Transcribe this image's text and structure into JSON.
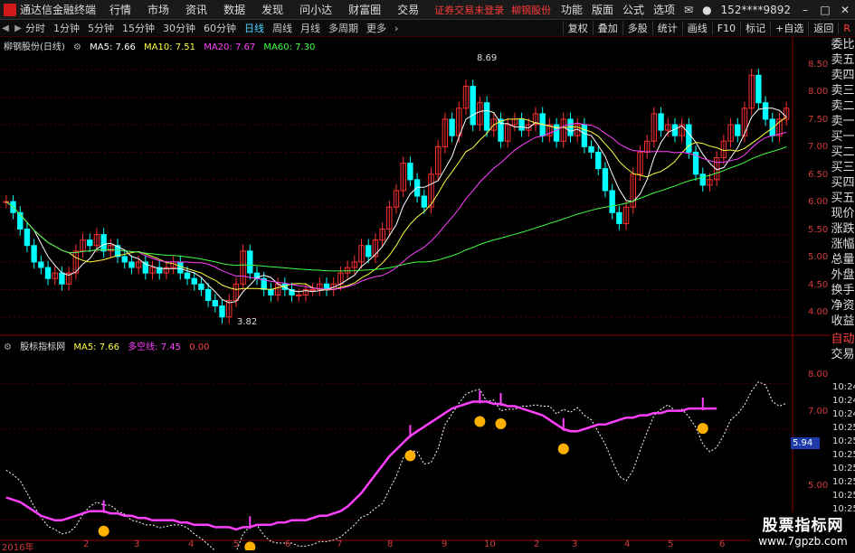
{
  "app": {
    "title": "通达信金融终端"
  },
  "menu": {
    "items": [
      "行情",
      "市场",
      "资讯",
      "数据",
      "发现",
      "问小达",
      "财富圈",
      "交易"
    ],
    "warning": "证券交易未登录",
    "stock_name": "柳钢股份",
    "right_items": [
      "功能",
      "版面",
      "公式",
      "选项"
    ],
    "account": "152****9892"
  },
  "toolbar": {
    "periods": [
      "分时",
      "1分钟",
      "5分钟",
      "15分钟",
      "30分钟",
      "60分钟",
      "日线",
      "周线",
      "月线",
      "多周期",
      "更多"
    ],
    "active": "日线",
    "right_buttons": [
      "复权",
      "叠加",
      "多股",
      "统计",
      "画线",
      "F10",
      "标记",
      "+自选",
      "返回"
    ],
    "r_label": "R"
  },
  "main_panel": {
    "title": "柳钢股份(日线)",
    "ma5": "MA5: 7.66",
    "ma10": "MA10: 7.51",
    "ma20": "MA20: 7.67",
    "ma60": "MA60: 7.30",
    "high_label": "8.69",
    "low_label": "3.82",
    "y_ticks": [
      "8.50",
      "8.00",
      "7.50",
      "7.00",
      "6.50",
      "6.00",
      "5.50",
      "5.00",
      "4.50",
      "4.00"
    ]
  },
  "sub_panel": {
    "title": "股标指标网",
    "ma5": "MA5: 7.66",
    "line_name": "多空线: 7.45",
    "extra": "0.00",
    "y_ticks": [
      "8.00",
      "7.00",
      "5.00"
    ],
    "current_value": "5.94"
  },
  "sidebar": {
    "items": [
      "委比",
      "卖五",
      "卖四",
      "卖三",
      "卖二",
      "卖一",
      "买一",
      "买二",
      "买三",
      "买四",
      "买五",
      "现价",
      "涨跌",
      "涨幅",
      "总量",
      "外盘",
      "换手",
      "净资",
      "收益"
    ],
    "auto_label": "自动",
    "trade_label": "交易",
    "times": [
      "10:24",
      "10:24",
      "10:24",
      "10:25",
      "10:25",
      "10:25",
      "10:25",
      "10:25",
      "10:25",
      "10:25"
    ]
  },
  "x_axis": {
    "labels": [
      "2016年",
      "2",
      "3",
      "4",
      "5",
      "6",
      "7",
      "8",
      "9",
      "10",
      "2",
      "3",
      "4",
      "5",
      "6"
    ]
  },
  "watermark": {
    "line1": "股票指标网",
    "line2": "www.7gpzb.com"
  },
  "colors": {
    "up": "#ff3030",
    "down": "#00ffff",
    "ma5": "#ffffff",
    "ma10": "#ffff40",
    "ma20": "#ff40ff",
    "ma60": "#40ff40",
    "pink": "#ff40ff",
    "signal": "#ffb000"
  },
  "chart_data": {
    "type": "candlestick",
    "title": "柳钢股份(日线)",
    "ylim": [
      3.7,
      8.8
    ],
    "close": [
      6.1,
      5.9,
      5.6,
      5.3,
      5.0,
      4.9,
      4.7,
      4.8,
      4.6,
      4.8,
      5.2,
      5.4,
      5.3,
      5.5,
      5.2,
      5.3,
      5.1,
      5.0,
      4.9,
      5.0,
      4.8,
      4.9,
      4.8,
      4.9,
      5.0,
      4.8,
      4.7,
      4.6,
      4.5,
      4.3,
      4.2,
      4.0,
      4.3,
      4.6,
      5.2,
      4.8,
      4.7,
      4.5,
      4.4,
      4.6,
      4.5,
      4.4,
      4.4,
      4.5,
      4.5,
      4.6,
      4.5,
      4.6,
      4.8,
      4.9,
      5.0,
      5.3,
      5.1,
      5.4,
      5.6,
      6.0,
      6.3,
      6.8,
      6.5,
      6.2,
      6.0,
      6.6,
      7.1,
      7.6,
      7.3,
      7.8,
      8.2,
      7.5,
      7.9,
      7.4,
      7.6,
      7.2,
      7.5,
      7.6,
      7.4,
      7.5,
      7.7,
      7.3,
      7.5,
      7.2,
      7.6,
      7.3,
      7.5,
      7.1,
      7.0,
      6.7,
      6.3,
      5.9,
      5.7,
      6.0,
      6.6,
      7.0,
      7.2,
      7.7,
      7.4,
      7.5,
      7.3,
      7.5,
      7.0,
      6.6,
      6.4,
      6.5,
      6.9,
      7.2,
      7.5,
      7.3,
      7.8,
      8.4,
      7.9,
      7.6,
      7.3,
      7.6,
      7.8
    ],
    "sub_line": [
      5.5,
      5.45,
      5.4,
      5.3,
      5.2,
      5.1,
      5.05,
      5.0,
      5.0,
      5.05,
      5.1,
      5.15,
      5.2,
      5.2,
      5.2,
      5.15,
      5.15,
      5.1,
      5.1,
      5.05,
      5.05,
      5.0,
      5.0,
      5.0,
      5.0,
      4.95,
      4.95,
      4.9,
      4.9,
      4.9,
      4.85,
      4.85,
      4.85,
      4.8,
      4.85,
      4.85,
      4.9,
      4.9,
      4.9,
      4.95,
      4.95,
      5.0,
      5.0,
      5.0,
      5.05,
      5.1,
      5.1,
      5.15,
      5.2,
      5.3,
      5.45,
      5.6,
      5.8,
      6.0,
      6.2,
      6.4,
      6.55,
      6.7,
      6.85,
      6.95,
      7.05,
      7.15,
      7.25,
      7.35,
      7.45,
      7.5,
      7.55,
      7.6,
      7.6,
      7.6,
      7.55,
      7.55,
      7.5,
      7.5,
      7.45,
      7.4,
      7.35,
      7.3,
      7.2,
      7.1,
      7.0,
      6.95,
      6.95,
      7.0,
      7.05,
      7.1,
      7.1,
      7.15,
      7.2,
      7.25,
      7.25,
      7.3,
      7.3,
      7.35,
      7.35,
      7.4,
      7.4,
      7.4,
      7.45,
      7.45,
      7.45,
      7.45,
      7.45
    ]
  }
}
